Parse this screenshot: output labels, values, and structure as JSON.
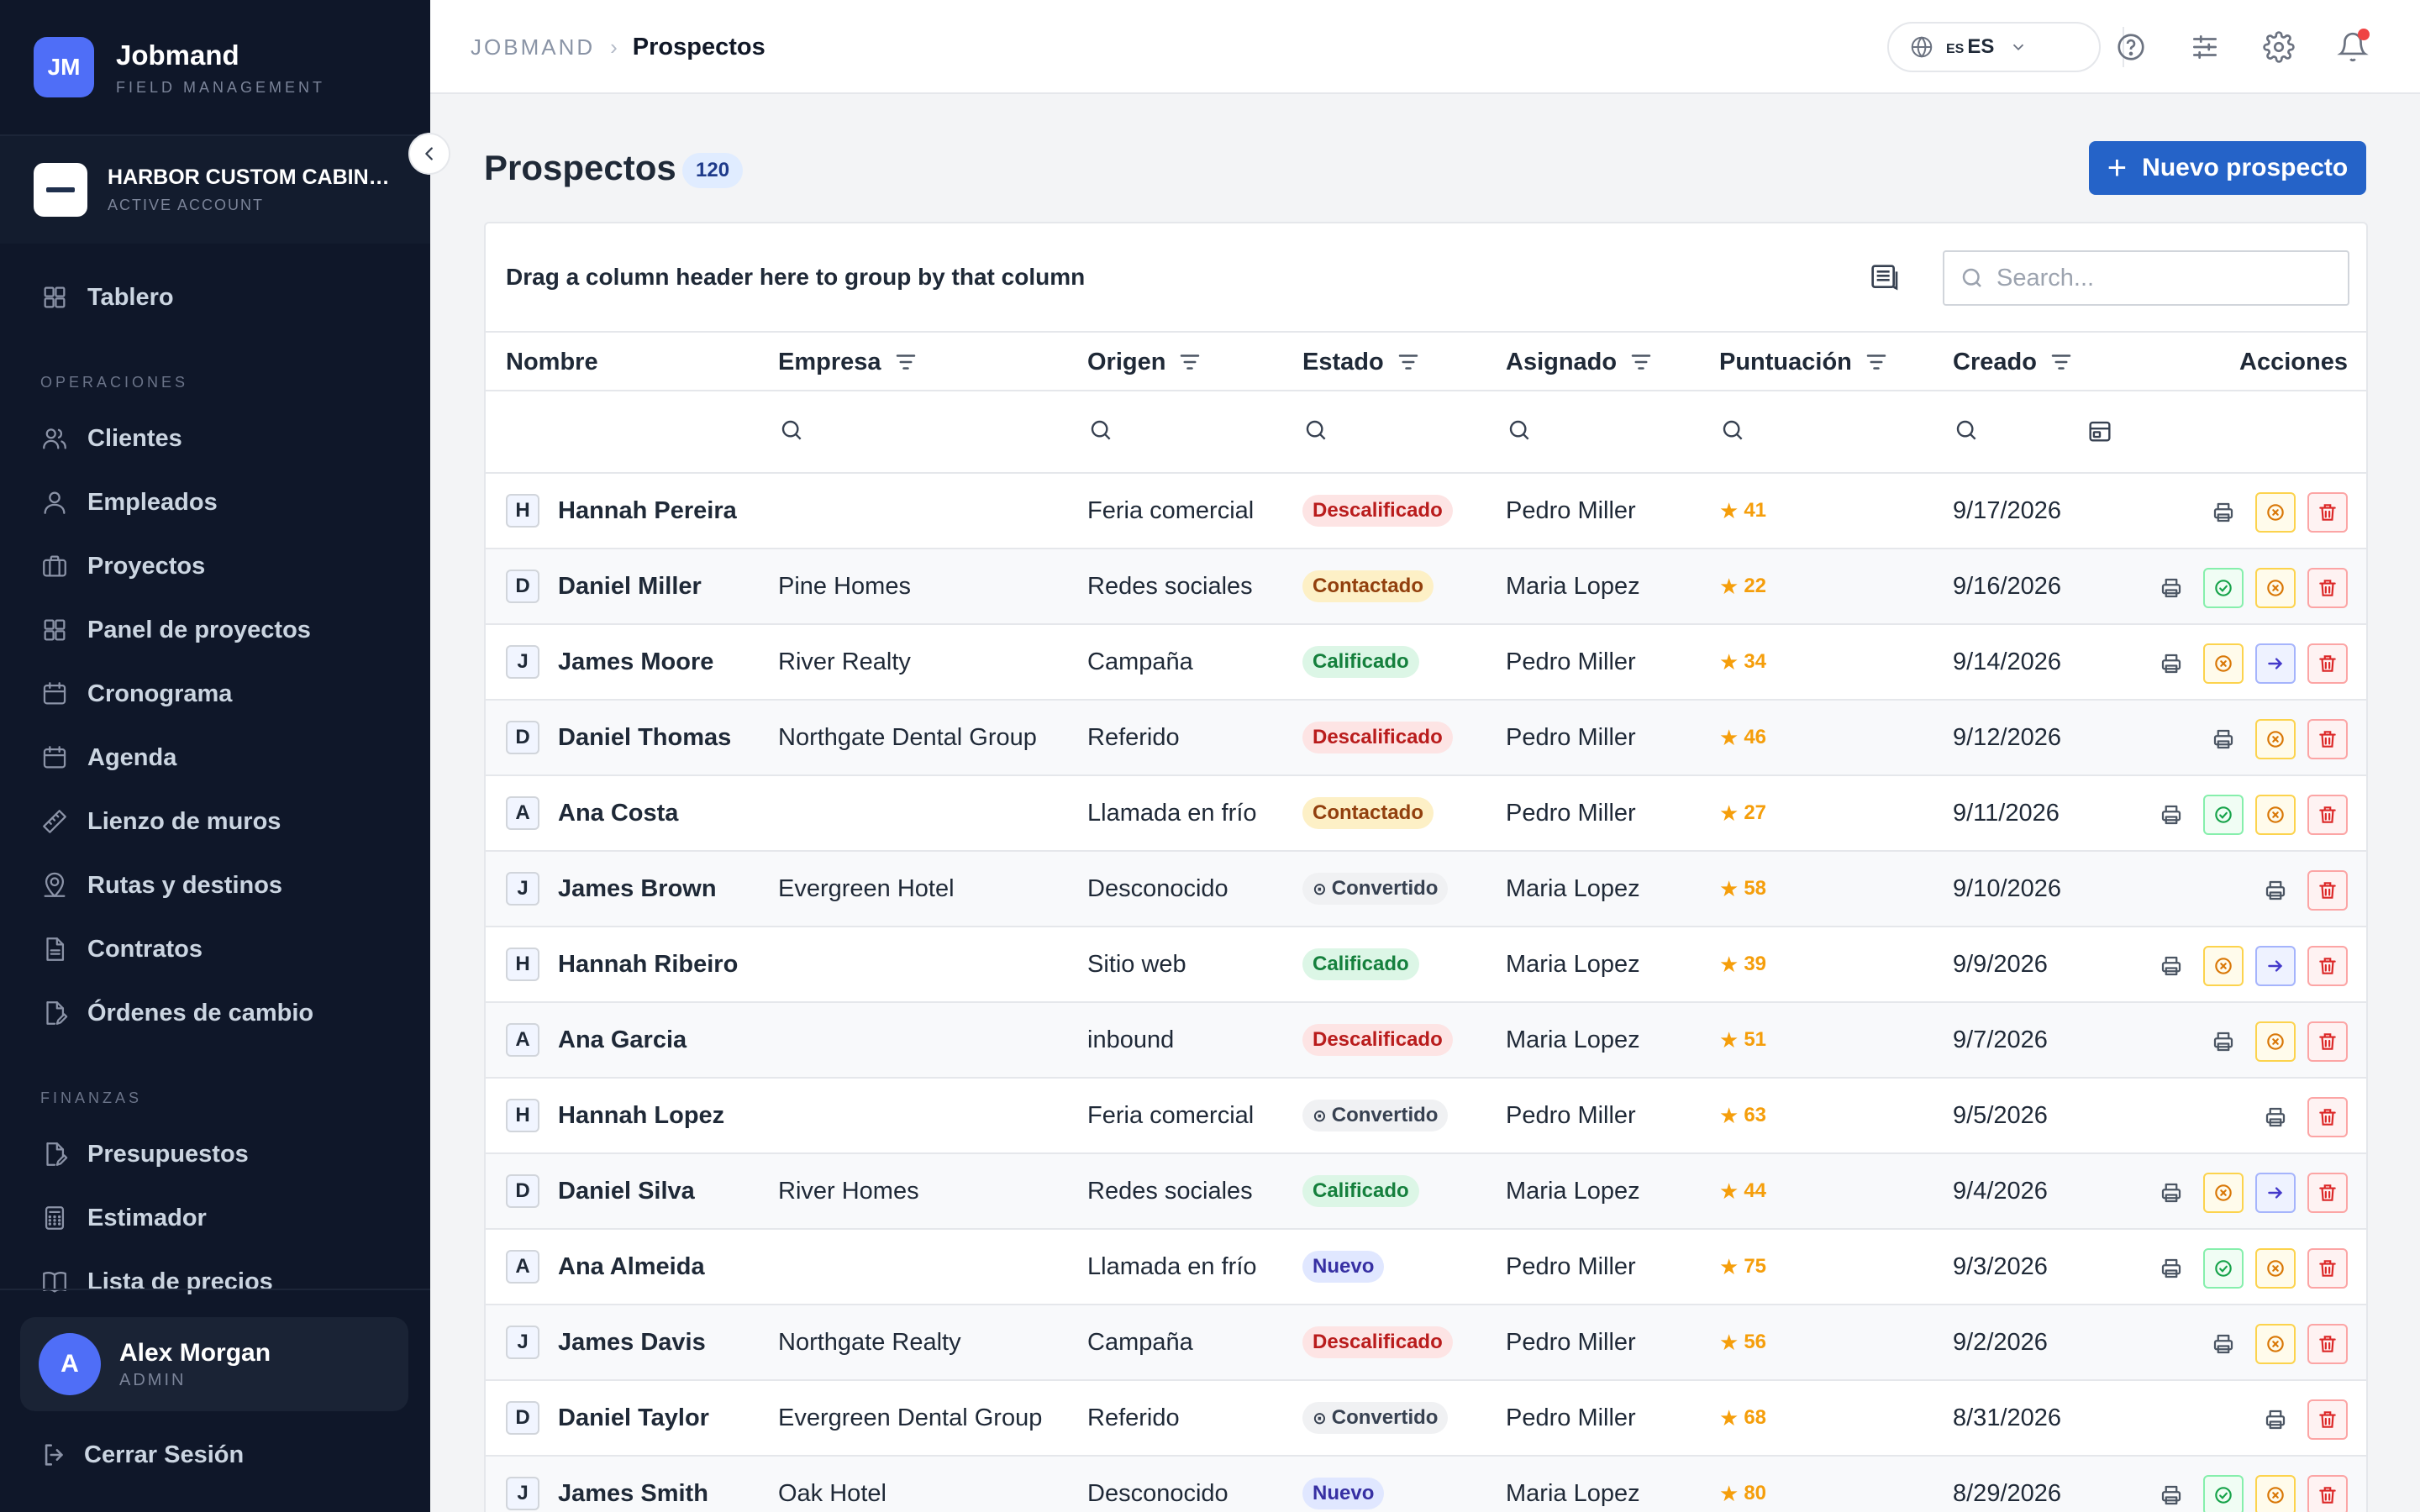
{
  "brand": {
    "logo": "JM",
    "name": "Jobmand",
    "subtitle": "FIELD MANAGEMENT"
  },
  "account": {
    "name": "HARBOR CUSTOM CABINETRY",
    "status": "ACTIVE ACCOUNT"
  },
  "nav": {
    "dashboard": {
      "label": "Tablero",
      "icon": "grid-icon"
    },
    "sections": [
      {
        "title": "OPERACIONES",
        "items": [
          {
            "label": "Clientes",
            "icon": "users-icon"
          },
          {
            "label": "Empleados",
            "icon": "user-icon"
          },
          {
            "label": "Proyectos",
            "icon": "briefcase-icon"
          },
          {
            "label": "Panel de proyectos",
            "icon": "grid-icon"
          },
          {
            "label": "Cronograma",
            "icon": "calendar-icon"
          },
          {
            "label": "Agenda",
            "icon": "calendar-icon"
          },
          {
            "label": "Lienzo de muros",
            "icon": "ruler-icon"
          },
          {
            "label": "Rutas y destinos",
            "icon": "map-pin-icon"
          },
          {
            "label": "Contratos",
            "icon": "document-icon"
          },
          {
            "label": "Órdenes de cambio",
            "icon": "document-edit-icon"
          }
        ]
      },
      {
        "title": "FINANZAS",
        "items": [
          {
            "label": "Presupuestos",
            "icon": "document-edit-icon"
          },
          {
            "label": "Estimador",
            "icon": "calculator-icon"
          },
          {
            "label": "Lista de precios",
            "icon": "book-icon"
          }
        ]
      }
    ]
  },
  "user": {
    "initial": "A",
    "name": "Alex Morgan",
    "role": "ADMIN"
  },
  "logout": "Cerrar Sesión",
  "header": {
    "breadcrumb_root": "JOBMAND",
    "breadcrumb_current": "Prospectos",
    "lang_flag": "ES",
    "lang": "ES"
  },
  "page": {
    "title": "Prospectos",
    "count": "120",
    "new_button": "Nuevo prospecto"
  },
  "grid": {
    "group_hint": "Drag a column header here to group by that column",
    "search_placeholder": "Search...",
    "columns": [
      "Nombre",
      "Empresa",
      "Origen",
      "Estado",
      "Asignado",
      "Puntuación",
      "Creado",
      "Acciones"
    ],
    "rows": [
      {
        "initial": "H",
        "name": "Hannah Pereira",
        "company": "",
        "origin": "Feria comercial",
        "status": "Descalificado",
        "assigned": "Pedro Miller",
        "score": "41",
        "created": "9/17/2026",
        "actions": [
          "print",
          "disqualify",
          "delete"
        ]
      },
      {
        "initial": "D",
        "name": "Daniel Miller",
        "company": "Pine Homes",
        "origin": "Redes sociales",
        "status": "Contactado",
        "assigned": "Maria Lopez",
        "score": "22",
        "created": "9/16/2026",
        "actions": [
          "print",
          "approve",
          "disqualify",
          "delete"
        ]
      },
      {
        "initial": "J",
        "name": "James Moore",
        "company": "River Realty",
        "origin": "Campaña",
        "status": "Calificado",
        "assigned": "Pedro Miller",
        "score": "34",
        "created": "9/14/2026",
        "actions": [
          "print",
          "disqualify",
          "convert",
          "delete"
        ]
      },
      {
        "initial": "D",
        "name": "Daniel Thomas",
        "company": "Northgate Dental Group",
        "origin": "Referido",
        "status": "Descalificado",
        "assigned": "Pedro Miller",
        "score": "46",
        "created": "9/12/2026",
        "actions": [
          "print",
          "disqualify",
          "delete"
        ]
      },
      {
        "initial": "A",
        "name": "Ana Costa",
        "company": "",
        "origin": "Llamada en frío",
        "status": "Contactado",
        "assigned": "Pedro Miller",
        "score": "27",
        "created": "9/11/2026",
        "actions": [
          "print",
          "approve",
          "disqualify",
          "delete"
        ]
      },
      {
        "initial": "J",
        "name": "James Brown",
        "company": "Evergreen Hotel",
        "origin": "Desconocido",
        "status": "Convertido",
        "assigned": "Maria Lopez",
        "score": "58",
        "created": "9/10/2026",
        "actions": [
          "print",
          "delete"
        ]
      },
      {
        "initial": "H",
        "name": "Hannah Ribeiro",
        "company": "",
        "origin": "Sitio web",
        "status": "Calificado",
        "assigned": "Maria Lopez",
        "score": "39",
        "created": "9/9/2026",
        "actions": [
          "print",
          "disqualify",
          "convert",
          "delete"
        ]
      },
      {
        "initial": "A",
        "name": "Ana Garcia",
        "company": "",
        "origin": "inbound",
        "status": "Descalificado",
        "assigned": "Maria Lopez",
        "score": "51",
        "created": "9/7/2026",
        "actions": [
          "print",
          "disqualify",
          "delete"
        ]
      },
      {
        "initial": "H",
        "name": "Hannah Lopez",
        "company": "",
        "origin": "Feria comercial",
        "status": "Convertido",
        "assigned": "Pedro Miller",
        "score": "63",
        "created": "9/5/2026",
        "actions": [
          "print",
          "delete"
        ]
      },
      {
        "initial": "D",
        "name": "Daniel Silva",
        "company": "River Homes",
        "origin": "Redes sociales",
        "status": "Calificado",
        "assigned": "Maria Lopez",
        "score": "44",
        "created": "9/4/2026",
        "actions": [
          "print",
          "disqualify",
          "convert",
          "delete"
        ]
      },
      {
        "initial": "A",
        "name": "Ana Almeida",
        "company": "",
        "origin": "Llamada en frío",
        "status": "Nuevo",
        "assigned": "Pedro Miller",
        "score": "75",
        "created": "9/3/2026",
        "actions": [
          "print",
          "approve",
          "disqualify",
          "delete"
        ]
      },
      {
        "initial": "J",
        "name": "James Davis",
        "company": "Northgate Realty",
        "origin": "Campaña",
        "status": "Descalificado",
        "assigned": "Pedro Miller",
        "score": "56",
        "created": "9/2/2026",
        "actions": [
          "print",
          "disqualify",
          "delete"
        ]
      },
      {
        "initial": "D",
        "name": "Daniel Taylor",
        "company": "Evergreen Dental Group",
        "origin": "Referido",
        "status": "Convertido",
        "assigned": "Pedro Miller",
        "score": "68",
        "created": "8/31/2026",
        "actions": [
          "print",
          "delete"
        ]
      },
      {
        "initial": "J",
        "name": "James Smith",
        "company": "Oak Hotel",
        "origin": "Desconocido",
        "status": "Nuevo",
        "assigned": "Maria Lopez",
        "score": "80",
        "created": "8/29/2026",
        "actions": [
          "print",
          "approve",
          "disqualify",
          "delete"
        ]
      }
    ]
  },
  "colors": {
    "sidebar_bg": "#0f1729",
    "accent": "#2563c8",
    "brand": "#4f6ef7",
    "score": "#f59e0b"
  }
}
